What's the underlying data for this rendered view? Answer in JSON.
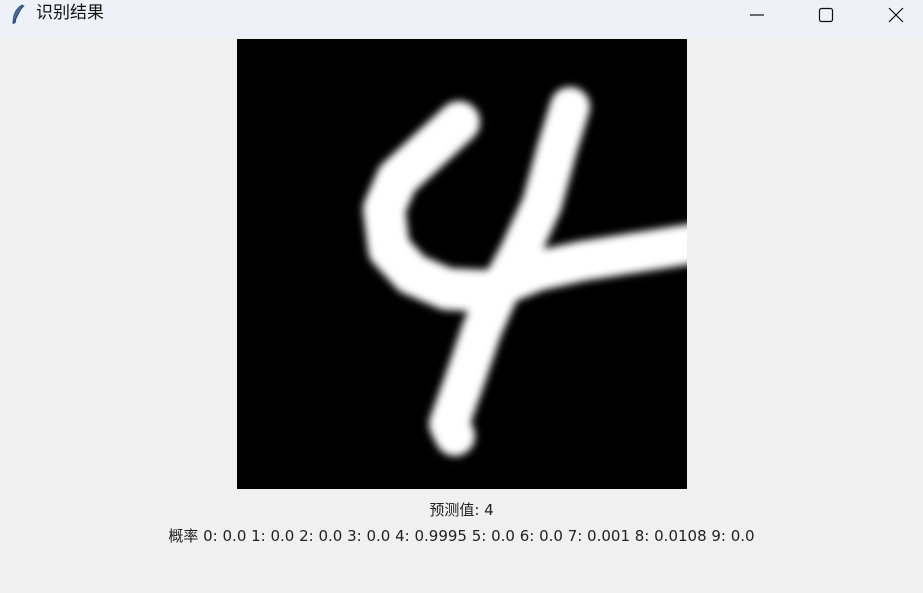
{
  "window": {
    "title": "识别结果",
    "app_icon": "feather-icon",
    "controls": {
      "minimize_icon": "minimize-icon",
      "maximize_icon": "maximize-icon",
      "close_icon": "close-icon"
    }
  },
  "image": {
    "description_icon": "digit-image",
    "background_color": "#000000",
    "stroke_color": "#ffffff"
  },
  "result": {
    "prediction_text": "预测值: 4",
    "probability_text": "概率 0: 0.0 1: 0.0 2: 0.0 3: 0.0 4: 0.9995 5: 0.0 6: 0.0 7: 0.001 8: 0.0108 9: 0.0"
  }
}
